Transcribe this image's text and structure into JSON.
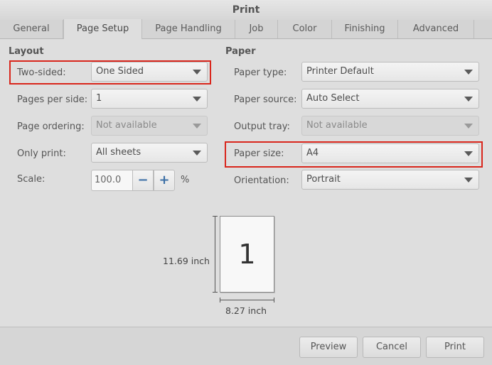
{
  "window": {
    "title": "Print"
  },
  "tabs": [
    {
      "label": "General"
    },
    {
      "label": "Page Setup"
    },
    {
      "label": "Page Handling"
    },
    {
      "label": "Job"
    },
    {
      "label": "Color"
    },
    {
      "label": "Finishing"
    },
    {
      "label": "Advanced"
    }
  ],
  "active_tab": "Page Setup",
  "layout": {
    "title": "Layout",
    "two_sided": {
      "label": "Two-sided:",
      "value": "One Sided"
    },
    "pages_per_side": {
      "label": "Pages per side:",
      "value": "1"
    },
    "page_ordering": {
      "label": "Page ordering:",
      "value": "Not available"
    },
    "only_print": {
      "label": "Only print:",
      "value": "All sheets"
    },
    "scale": {
      "label": "Scale:",
      "value": "100.0",
      "unit": "%"
    }
  },
  "paper": {
    "title": "Paper",
    "paper_type": {
      "label": "Paper type:",
      "value": "Printer Default"
    },
    "paper_source": {
      "label": "Paper source:",
      "value": "Auto Select"
    },
    "output_tray": {
      "label": "Output tray:",
      "value": "Not available"
    },
    "paper_size": {
      "label": "Paper size:",
      "value": "A4"
    },
    "orientation": {
      "label": "Orientation:",
      "value": "Portrait"
    }
  },
  "preview": {
    "page_number": "1",
    "height_label": "11.69 inch",
    "width_label": "8.27 inch"
  },
  "buttons": {
    "preview": "Preview",
    "cancel": "Cancel",
    "print": "Print"
  },
  "colors": {
    "highlight": "#d9261c",
    "spin_icon": "#3a6ea5"
  }
}
